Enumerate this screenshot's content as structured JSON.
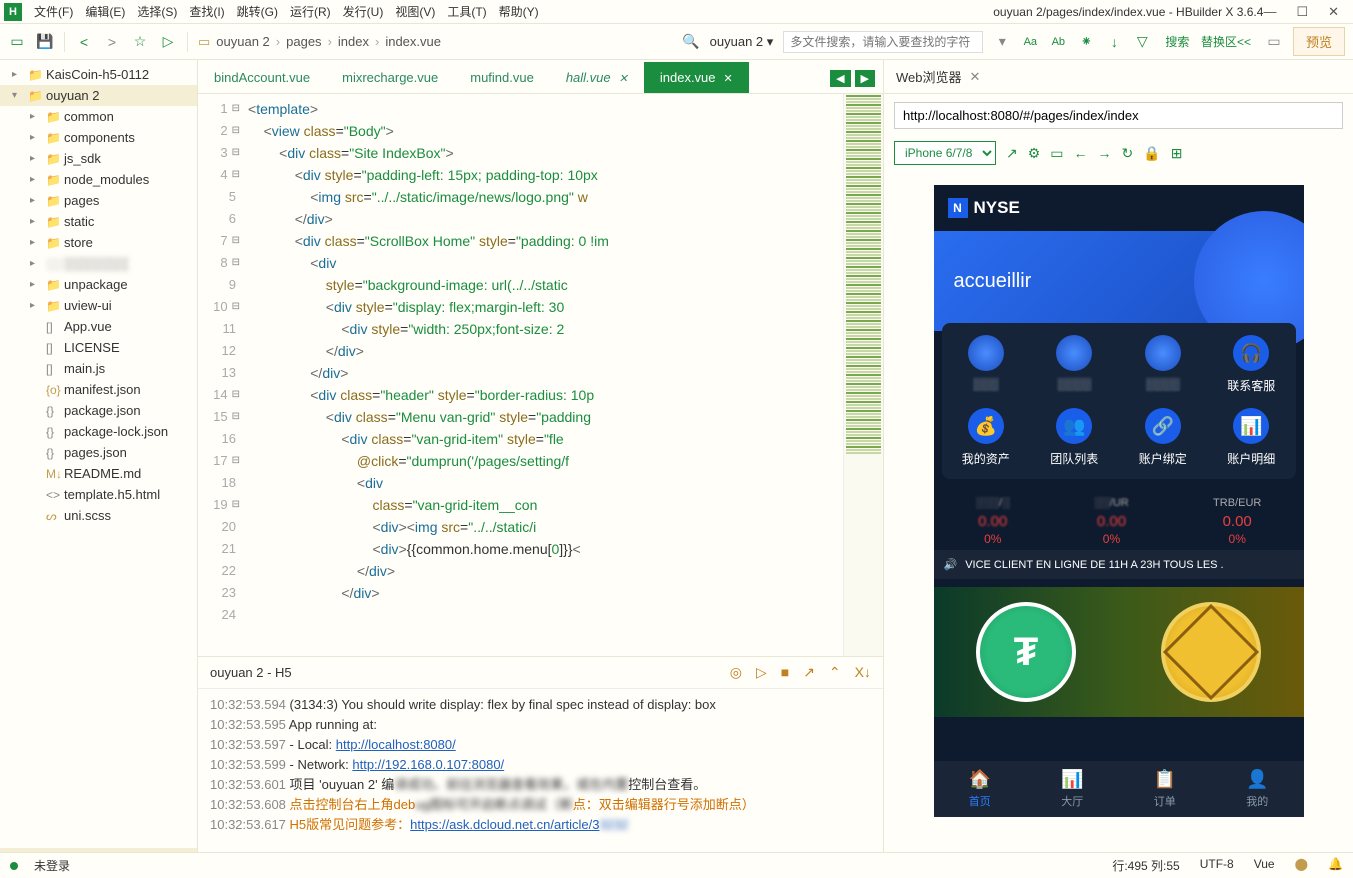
{
  "titlebar": {
    "menus": [
      "文件(F)",
      "编辑(E)",
      "选择(S)",
      "查找(I)",
      "跳转(G)",
      "运行(R)",
      "发行(U)",
      "视图(V)",
      "工具(T)",
      "帮助(Y)"
    ],
    "title": "ouyuan 2/pages/index/index.vue - HBuilder X 3.6.4"
  },
  "toolbar": {
    "breadcrumb": [
      "ouyuan 2",
      "pages",
      "index",
      "index.vue"
    ],
    "search_placeholder": "多文件搜索，请输入要查找的字符",
    "rbtns": [
      "搜索",
      "替换区<<"
    ],
    "preview": "预览"
  },
  "tree": {
    "items": [
      {
        "ind": 0,
        "exp": "▸",
        "ico": "📁",
        "label": "KaisCoin-h5-0112",
        "c": "#c29b4c"
      },
      {
        "ind": 0,
        "exp": "▾",
        "ico": "📁",
        "label": "ouyuan 2",
        "c": "#c29b4c",
        "sel": true
      },
      {
        "ind": 1,
        "exp": "▸",
        "ico": "📁",
        "label": "common",
        "c": "#c29b4c"
      },
      {
        "ind": 1,
        "exp": "▸",
        "ico": "📁",
        "label": "components",
        "c": "#c29b4c"
      },
      {
        "ind": 1,
        "exp": "▸",
        "ico": "📁",
        "label": "js_sdk",
        "c": "#c29b4c"
      },
      {
        "ind": 1,
        "exp": "▸",
        "ico": "📁",
        "label": "node_modules",
        "c": "#c29b4c"
      },
      {
        "ind": 1,
        "exp": "▸",
        "ico": "📁",
        "label": "pages",
        "c": "#c29b4c"
      },
      {
        "ind": 1,
        "exp": "▸",
        "ico": "📁",
        "label": "static",
        "c": "#c29b4c"
      },
      {
        "ind": 1,
        "exp": "▸",
        "ico": "📁",
        "label": "store",
        "c": "#c29b4c"
      },
      {
        "ind": 1,
        "exp": "▸",
        "ico": "░░",
        "label": "░░░░░░░",
        "c": "#aaa",
        "blur": true
      },
      {
        "ind": 1,
        "exp": "▸",
        "ico": "📁",
        "label": "unpackage",
        "c": "#c29b4c"
      },
      {
        "ind": 1,
        "exp": "▸",
        "ico": "📁",
        "label": "uview-ui",
        "c": "#888"
      },
      {
        "ind": 1,
        "exp": "",
        "ico": "[]",
        "label": "App.vue",
        "c": "#888"
      },
      {
        "ind": 1,
        "exp": "",
        "ico": "[]",
        "label": "LICENSE",
        "c": "#888"
      },
      {
        "ind": 1,
        "exp": "",
        "ico": "[]",
        "label": "main.js",
        "c": "#888"
      },
      {
        "ind": 1,
        "exp": "",
        "ico": "{o}",
        "label": "manifest.json",
        "c": "#c29b4c"
      },
      {
        "ind": 1,
        "exp": "",
        "ico": "{}",
        "label": "package.json",
        "c": "#888"
      },
      {
        "ind": 1,
        "exp": "",
        "ico": "{}",
        "label": "package-lock.json",
        "c": "#888"
      },
      {
        "ind": 1,
        "exp": "",
        "ico": "{}",
        "label": "pages.json",
        "c": "#888"
      },
      {
        "ind": 1,
        "exp": "",
        "ico": "M↓",
        "label": "README.md",
        "c": "#c29b4c"
      },
      {
        "ind": 1,
        "exp": "",
        "ico": "<>",
        "label": "template.h5.html",
        "c": "#888"
      },
      {
        "ind": 1,
        "exp": "",
        "ico": "ᔕ",
        "label": "uni.scss",
        "c": "#c29b4c"
      }
    ]
  },
  "tabs": [
    {
      "label": "bindAccount.vue",
      "active": false
    },
    {
      "label": "mixrecharge.vue",
      "active": false
    },
    {
      "label": "mufind.vue",
      "active": false
    },
    {
      "label": "hall.vue",
      "active": false,
      "close": true,
      "italic": true
    },
    {
      "label": "index.vue",
      "active": true
    }
  ],
  "code": {
    "lines": [
      {
        "n": 1,
        "f": "⊟",
        "h": "<span class='pn'>&lt;</span><span class='tg'>template</span><span class='pn'>&gt;</span>"
      },
      {
        "n": 2,
        "f": "⊟",
        "h": "    <span class='pn'>&lt;</span><span class='tg'>view</span> <span class='at'>class</span><span class='op'>=</span><span class='st'>\"Body\"</span><span class='pn'>&gt;</span>"
      },
      {
        "n": 3,
        "f": "⊟",
        "h": "        <span class='pn'>&lt;</span><span class='tg'>div</span> <span class='at'>class</span><span class='op'>=</span><span class='st'>\"Site IndexBox\"</span><span class='pn'>&gt;</span>"
      },
      {
        "n": 4,
        "f": "⊟",
        "h": "            <span class='pn'>&lt;</span><span class='tg'>div</span> <span class='at'>style</span><span class='op'>=</span><span class='st'>\"padding-left: 15px; padding-top: 10px</span>"
      },
      {
        "n": 5,
        "f": "",
        "h": "                <span class='pn'>&lt;</span><span class='tg'>img</span> <span class='at'>src</span><span class='op'>=</span><span class='st'>\"../../static/image/news/logo.png\"</span> <span class='at'>w</span>"
      },
      {
        "n": 6,
        "f": "",
        "h": "            <span class='pn'>&lt;/</span><span class='tg'>div</span><span class='pn'>&gt;</span>"
      },
      {
        "n": 7,
        "f": "⊟",
        "h": "            <span class='pn'>&lt;</span><span class='tg'>div</span> <span class='at'>class</span><span class='op'>=</span><span class='st'>\"ScrollBox Home\"</span> <span class='at'>style</span><span class='op'>=</span><span class='st'>\"padding: 0 !im</span>"
      },
      {
        "n": 8,
        "f": "⊟",
        "h": "                <span class='pn'>&lt;</span><span class='tg'>div</span>"
      },
      {
        "n": 9,
        "f": "",
        "h": "                    <span class='at'>style</span><span class='op'>=</span><span class='st'>\"background-image: url(../../static</span>"
      },
      {
        "n": 10,
        "f": "⊟",
        "h": "                    <span class='pn'>&lt;</span><span class='tg'>div</span> <span class='at'>style</span><span class='op'>=</span><span class='st'>\"display: flex;margin-left: 30</span>"
      },
      {
        "n": 11,
        "f": "",
        "h": "                        <span class='pn'>&lt;</span><span class='tg'>div</span> <span class='at'>style</span><span class='op'>=</span><span class='st'>\"width: 250px;font-size: 2</span>"
      },
      {
        "n": 12,
        "f": "",
        "h": "                    <span class='pn'>&lt;/</span><span class='tg'>div</span><span class='pn'>&gt;</span>"
      },
      {
        "n": 13,
        "f": "",
        "h": "                <span class='pn'>&lt;/</span><span class='tg'>div</span><span class='pn'>&gt;</span>"
      },
      {
        "n": 14,
        "f": "⊟",
        "h": "                <span class='pn'>&lt;</span><span class='tg'>div</span> <span class='at'>class</span><span class='op'>=</span><span class='st'>\"header\"</span> <span class='at'>style</span><span class='op'>=</span><span class='st'>\"border-radius: 10p</span>"
      },
      {
        "n": 15,
        "f": "⊟",
        "h": "                    <span class='pn'>&lt;</span><span class='tg'>div</span> <span class='at'>class</span><span class='op'>=</span><span class='st'>\"Menu van-grid\"</span> <span class='at'>style</span><span class='op'>=</span><span class='st'>\"padding</span>"
      },
      {
        "n": 16,
        "f": "",
        "h": ""
      },
      {
        "n": 17,
        "f": "⊟",
        "h": "                        <span class='pn'>&lt;</span><span class='tg'>div</span> <span class='at'>class</span><span class='op'>=</span><span class='st'>\"van-grid-item\"</span> <span class='at'>style</span><span class='op'>=</span><span class='st'>\"fle</span>"
      },
      {
        "n": 18,
        "f": "",
        "h": "                            <span class='at'>@click</span><span class='op'>=</span><span class='st'>\"dumprun('/pages/setting/f</span>"
      },
      {
        "n": 19,
        "f": "⊟",
        "h": "                            <span class='pn'>&lt;</span><span class='tg'>div</span>"
      },
      {
        "n": 20,
        "f": "",
        "h": "                                <span class='at'>class</span><span class='op'>=</span><span class='st'>\"van-grid-item__con</span>"
      },
      {
        "n": 21,
        "f": "",
        "h": "                                <span class='pn'>&lt;</span><span class='tg'>div</span><span class='pn'>&gt;&lt;</span><span class='tg'>img</span> <span class='at'>src</span><span class='op'>=</span><span class='st'>\"../../static/i</span>"
      },
      {
        "n": 22,
        "f": "",
        "h": "                                <span class='pn'>&lt;</span><span class='tg'>div</span><span class='pn'>&gt;</span>{{common.home.menu[<span class='st'>0</span>]}}<span class='pn'>&lt;</span>"
      },
      {
        "n": 23,
        "f": "",
        "h": "                            <span class='pn'>&lt;/</span><span class='tg'>div</span><span class='pn'>&gt;</span>"
      },
      {
        "n": 24,
        "f": "",
        "h": "                        <span class='pn'>&lt;/</span><span class='tg'>div</span><span class='pn'>&gt;</span>"
      }
    ]
  },
  "console": {
    "title": "ouyuan 2 - H5",
    "lines": [
      {
        "ts": "10:32:53.594",
        "txt": "(3134:3) You should write display: flex by final spec instead of display: box"
      },
      {
        "ts": "10:32:53.595",
        "txt": "  App running at:"
      },
      {
        "ts": "10:32:53.597",
        "txt": "  - Local:   ",
        "link": "http://localhost:8080/"
      },
      {
        "ts": "10:32:53.599",
        "txt": "  - Network: ",
        "link": "http://192.168.0.107:8080/"
      },
      {
        "ts": "10:32:53.601",
        "txt": "项目 'ouyuan 2' 编",
        "blur": "译成功。前往浏览器查看效果，或在内置",
        "tail": "控制台查看。"
      },
      {
        "ts": "10:32:53.608",
        "orange": "点击控制台右上角deb",
        "blur": "ug图标可开启断点调试（断",
        "orangetail": "点：双击编辑器行号添加断点）"
      },
      {
        "ts": "10:32:53.617",
        "orange": "H5版常见问题参考：",
        "link": "https://ask.dcloud.net.cn/article/3",
        "linkblur": "3232"
      }
    ]
  },
  "browser": {
    "tab": "Web浏览器",
    "url": "http://localhost:8080/#/pages/index/index",
    "device": "iPhone 6/7/8"
  },
  "phone": {
    "logo": "NYSE",
    "banner": "accueillir",
    "menu1": [
      "░░░",
      "░░░░",
      "░░░░",
      "联系客服"
    ],
    "menu2": [
      "我的资产",
      "团队列表",
      "账户绑定",
      "账户明细"
    ],
    "ticker": [
      {
        "pair": "░░░/░",
        "val": "0.00",
        "pct": "0%"
      },
      {
        "pair": "░░/UR",
        "val": "0.00",
        "pct": "0%"
      },
      {
        "pair": "TRB/EUR",
        "val": "0.00",
        "pct": "0%",
        "clear": true
      }
    ],
    "marquee": "VICE CLIENT EN LIGNE DE 11H A 23H TOUS LES .",
    "nav": [
      {
        "ico": "🏠",
        "label": "首页",
        "act": true
      },
      {
        "ico": "📊",
        "label": "大厅"
      },
      {
        "ico": "📋",
        "label": "订单"
      },
      {
        "ico": "👤",
        "label": "我的"
      }
    ]
  },
  "status": {
    "login": "未登录",
    "pos": "行:495  列:55",
    "enc": "UTF-8",
    "lang": "Vue"
  }
}
